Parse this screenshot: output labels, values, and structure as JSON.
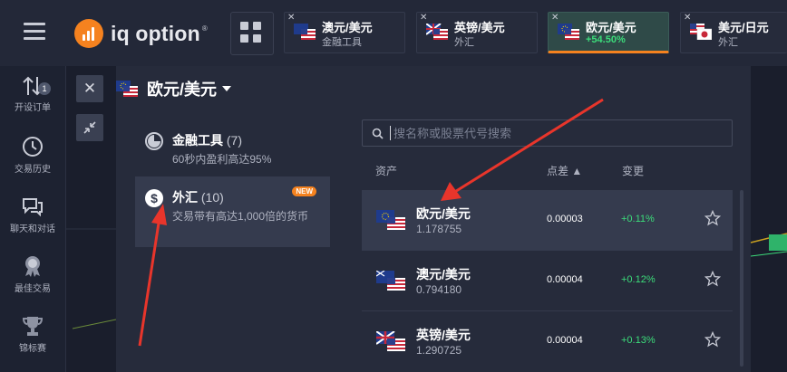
{
  "app": {
    "logo_text": "iq option",
    "logo_mark": "®"
  },
  "tabs": [
    {
      "title": "澳元/美元",
      "sub": "金融工具",
      "flag": "au-us"
    },
    {
      "title": "英镑/美元",
      "sub": "外汇",
      "flag": "gb-us"
    },
    {
      "title": "欧元/美元",
      "sub": "+54.50%",
      "flag": "eu-us",
      "active": true
    },
    {
      "title": "美元/日元",
      "sub": "外汇",
      "flag": "us-jp"
    }
  ],
  "sidebar": {
    "items": [
      {
        "label": "开设订单",
        "badge": "1",
        "icon": "arrows-updown-icon"
      },
      {
        "label": "交易历史",
        "icon": "clock-icon"
      },
      {
        "label": "聊天和对话",
        "icon": "chat-icon"
      },
      {
        "label": "最佳交易",
        "icon": "medal-icon"
      },
      {
        "label": "锦标赛",
        "icon": "trophy-icon"
      }
    ]
  },
  "panel": {
    "close_label": "✕",
    "title": "欧元/美元",
    "categories": [
      {
        "name": "金融工具",
        "count": "(7)",
        "desc": "60秒内盈利高达95%",
        "icon": "pie-icon"
      },
      {
        "name": "外汇",
        "count": "(10)",
        "desc": "交易带有高达1,000倍的货币",
        "badge": "NEW",
        "icon": "dollar-icon"
      }
    ],
    "search": {
      "placeholder": "搜名称或股票代号搜索"
    },
    "columns": {
      "asset": "资产",
      "spread": "点差 ▲",
      "change": "变更"
    },
    "rows": [
      {
        "name": "欧元/美元",
        "price": "1.178755",
        "spread": "0.00003",
        "change": "+0.11%",
        "flag": "eu-us"
      },
      {
        "name": "澳元/美元",
        "price": "0.794180",
        "spread": "0.00004",
        "change": "+0.12%",
        "flag": "au-us"
      },
      {
        "name": "英镑/美元",
        "price": "1.290725",
        "spread": "0.00004",
        "change": "+0.13%",
        "flag": "gb-us"
      }
    ]
  },
  "colors": {
    "accent": "#f5821f",
    "positive": "#3cdc7a",
    "annotation": "#e8352b"
  }
}
